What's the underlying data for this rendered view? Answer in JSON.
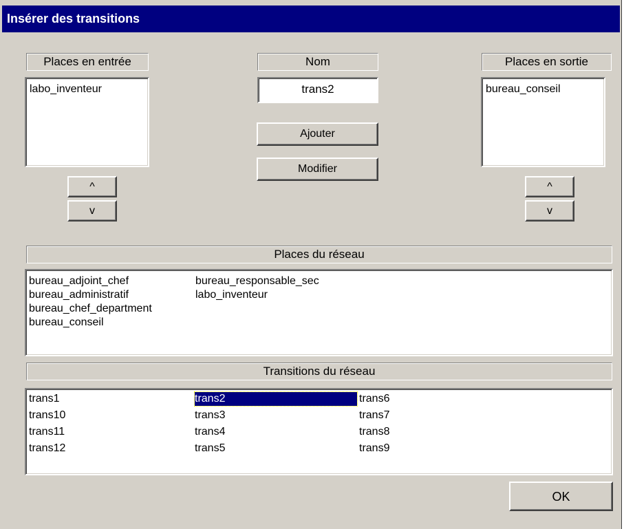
{
  "window": {
    "title": "Insérer des transitions"
  },
  "input_places": {
    "header": "Places en entrée",
    "items": [
      "labo_inventeur"
    ]
  },
  "output_places": {
    "header": "Places en sortie",
    "items": [
      "bureau_conseil"
    ]
  },
  "nom": {
    "header": "Nom",
    "value": "trans2"
  },
  "buttons": {
    "ajouter": "Ajouter",
    "modifier": "Modifier",
    "up": "^",
    "down": "v",
    "ok": "OK"
  },
  "network_places": {
    "header": "Places du réseau",
    "columns": [
      [
        "bureau_adjoint_chef",
        "bureau_administratif",
        "bureau_chef_department",
        "bureau_conseil"
      ],
      [
        "bureau_responsable_sec",
        "labo_inventeur"
      ]
    ]
  },
  "network_transitions": {
    "header": "Transitions du réseau",
    "selected": "trans2",
    "columns": [
      [
        "trans1",
        "trans10",
        "trans11",
        "trans12"
      ],
      [
        "trans2",
        "trans3",
        "trans4",
        "trans5"
      ],
      [
        "trans6",
        "trans7",
        "trans8",
        "trans9"
      ]
    ]
  }
}
